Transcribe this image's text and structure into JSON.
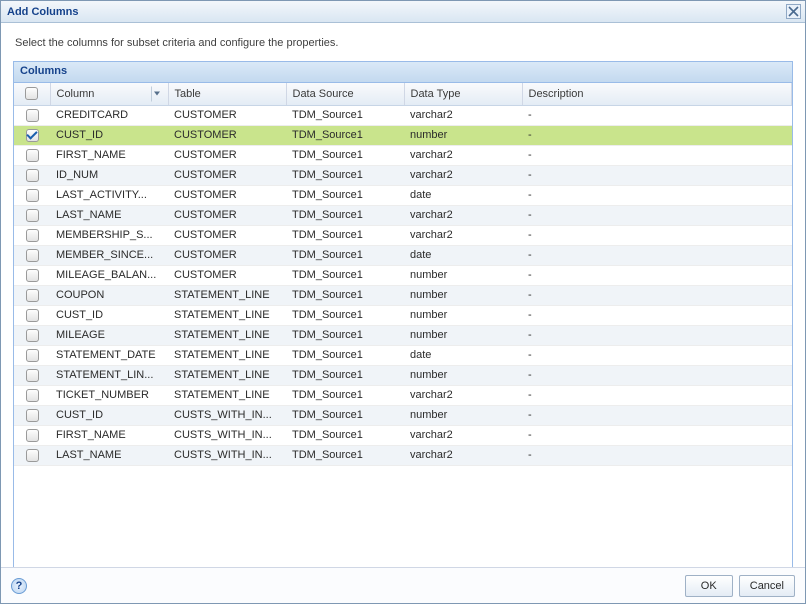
{
  "dialog": {
    "title": "Add Columns"
  },
  "desc": "Select the columns for subset criteria and configure the properties.",
  "panel": {
    "title": "Columns"
  },
  "headers": {
    "check": "",
    "column": "Column",
    "table": "Table",
    "source": "Data Source",
    "type": "Data Type",
    "desc": "Description"
  },
  "rows": [
    {
      "checked": false,
      "column": "CREDITCARD",
      "table": "CUSTOMER",
      "source": "TDM_Source1",
      "type": "varchar2",
      "desc": "-"
    },
    {
      "checked": true,
      "column": "CUST_ID",
      "table": "CUSTOMER",
      "source": "TDM_Source1",
      "type": "number",
      "desc": "-"
    },
    {
      "checked": false,
      "column": "FIRST_NAME",
      "table": "CUSTOMER",
      "source": "TDM_Source1",
      "type": "varchar2",
      "desc": "-"
    },
    {
      "checked": false,
      "column": "ID_NUM",
      "table": "CUSTOMER",
      "source": "TDM_Source1",
      "type": "varchar2",
      "desc": "-"
    },
    {
      "checked": false,
      "column": "LAST_ACTIVITY...",
      "table": "CUSTOMER",
      "source": "TDM_Source1",
      "type": "date",
      "desc": "-"
    },
    {
      "checked": false,
      "column": "LAST_NAME",
      "table": "CUSTOMER",
      "source": "TDM_Source1",
      "type": "varchar2",
      "desc": "-"
    },
    {
      "checked": false,
      "column": "MEMBERSHIP_S...",
      "table": "CUSTOMER",
      "source": "TDM_Source1",
      "type": "varchar2",
      "desc": "-"
    },
    {
      "checked": false,
      "column": "MEMBER_SINCE...",
      "table": "CUSTOMER",
      "source": "TDM_Source1",
      "type": "date",
      "desc": "-"
    },
    {
      "checked": false,
      "column": "MILEAGE_BALAN...",
      "table": "CUSTOMER",
      "source": "TDM_Source1",
      "type": "number",
      "desc": "-"
    },
    {
      "checked": false,
      "column": "COUPON",
      "table": "STATEMENT_LINE",
      "source": "TDM_Source1",
      "type": "number",
      "desc": "-"
    },
    {
      "checked": false,
      "column": "CUST_ID",
      "table": "STATEMENT_LINE",
      "source": "TDM_Source1",
      "type": "number",
      "desc": "-"
    },
    {
      "checked": false,
      "column": "MILEAGE",
      "table": "STATEMENT_LINE",
      "source": "TDM_Source1",
      "type": "number",
      "desc": "-"
    },
    {
      "checked": false,
      "column": "STATEMENT_DATE",
      "table": "STATEMENT_LINE",
      "source": "TDM_Source1",
      "type": "date",
      "desc": "-"
    },
    {
      "checked": false,
      "column": "STATEMENT_LIN...",
      "table": "STATEMENT_LINE",
      "source": "TDM_Source1",
      "type": "number",
      "desc": "-"
    },
    {
      "checked": false,
      "column": "TICKET_NUMBER",
      "table": "STATEMENT_LINE",
      "source": "TDM_Source1",
      "type": "varchar2",
      "desc": "-"
    },
    {
      "checked": false,
      "column": "CUST_ID",
      "table": "CUSTS_WITH_IN...",
      "source": "TDM_Source1",
      "type": "number",
      "desc": "-"
    },
    {
      "checked": false,
      "column": "FIRST_NAME",
      "table": "CUSTS_WITH_IN...",
      "source": "TDM_Source1",
      "type": "varchar2",
      "desc": "-"
    },
    {
      "checked": false,
      "column": "LAST_NAME",
      "table": "CUSTS_WITH_IN...",
      "source": "TDM_Source1",
      "type": "varchar2",
      "desc": "-"
    }
  ],
  "selected_index": 1,
  "footer": {
    "ok": "OK",
    "cancel": "Cancel",
    "help_glyph": "?"
  }
}
